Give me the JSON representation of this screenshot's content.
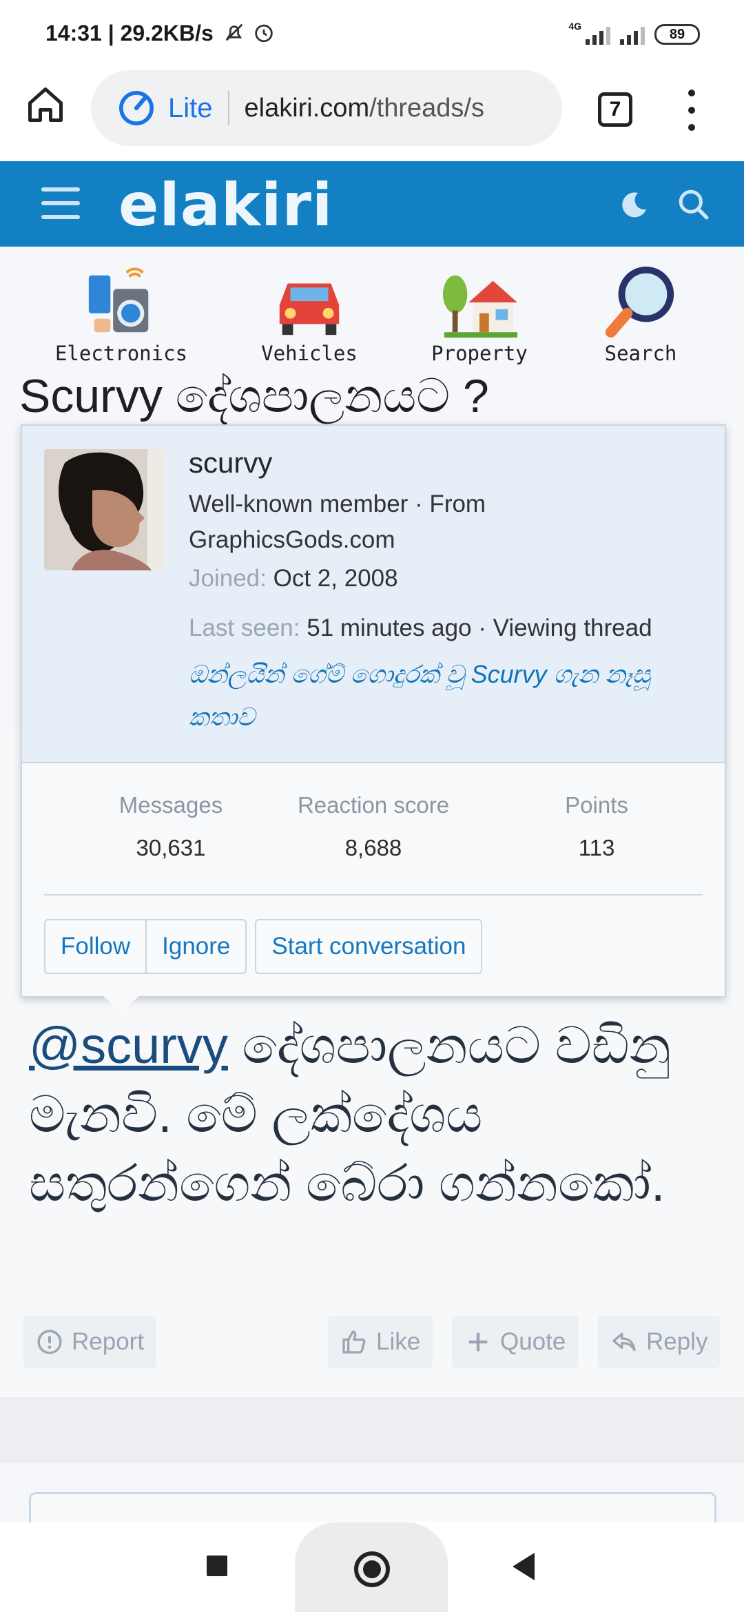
{
  "status_bar": {
    "time": "14:31",
    "net_speed": "29.2KB/s",
    "network_label": "4G",
    "battery": "89"
  },
  "browser": {
    "lite_label": "Lite",
    "url_domain": "elakiri.com",
    "url_path": "/threads/s",
    "tab_count": "7"
  },
  "site": {
    "logo": "elakiri",
    "brand_color": "#1380c4"
  },
  "categories": [
    {
      "label": "Electronics",
      "icon": "electronics-icon"
    },
    {
      "label": "Vehicles",
      "icon": "car-icon"
    },
    {
      "label": "Property",
      "icon": "house-icon"
    },
    {
      "label": "Search",
      "icon": "magnifier-icon"
    }
  ],
  "thread": {
    "title": "Scurvy දේශපාලනයට ?"
  },
  "profile_card": {
    "username": "scurvy",
    "user_title": "Well-known member · From GraphicsGods.com",
    "joined_label": "Joined:",
    "joined_value": "Oct 2, 2008",
    "last_seen_label": "Last seen:",
    "last_seen_value": "51 minutes ago · Viewing thread",
    "activity_link": "ඔන්ලයින් ගේම් ගොදුරක් වූ Scurvy ගැන නෑසූ කතාව",
    "stats": [
      {
        "label": "Messages",
        "value": "30,631"
      },
      {
        "label": "Reaction score",
        "value": "8,688"
      },
      {
        "label": "Points",
        "value": "113"
      }
    ],
    "buttons": {
      "follow": "Follow",
      "ignore": "Ignore",
      "start_conversation": "Start conversation"
    }
  },
  "post": {
    "mention": "@scurvy",
    "body": " දේශපාලනයට වඩිනු මැනවි. මේ ලක්දේශය සතුරන්ගෙන් බේරා ගන්නකෝ.",
    "actions": {
      "report": "Report",
      "like": "Like",
      "quote": "Quote",
      "reply": "Reply"
    }
  }
}
